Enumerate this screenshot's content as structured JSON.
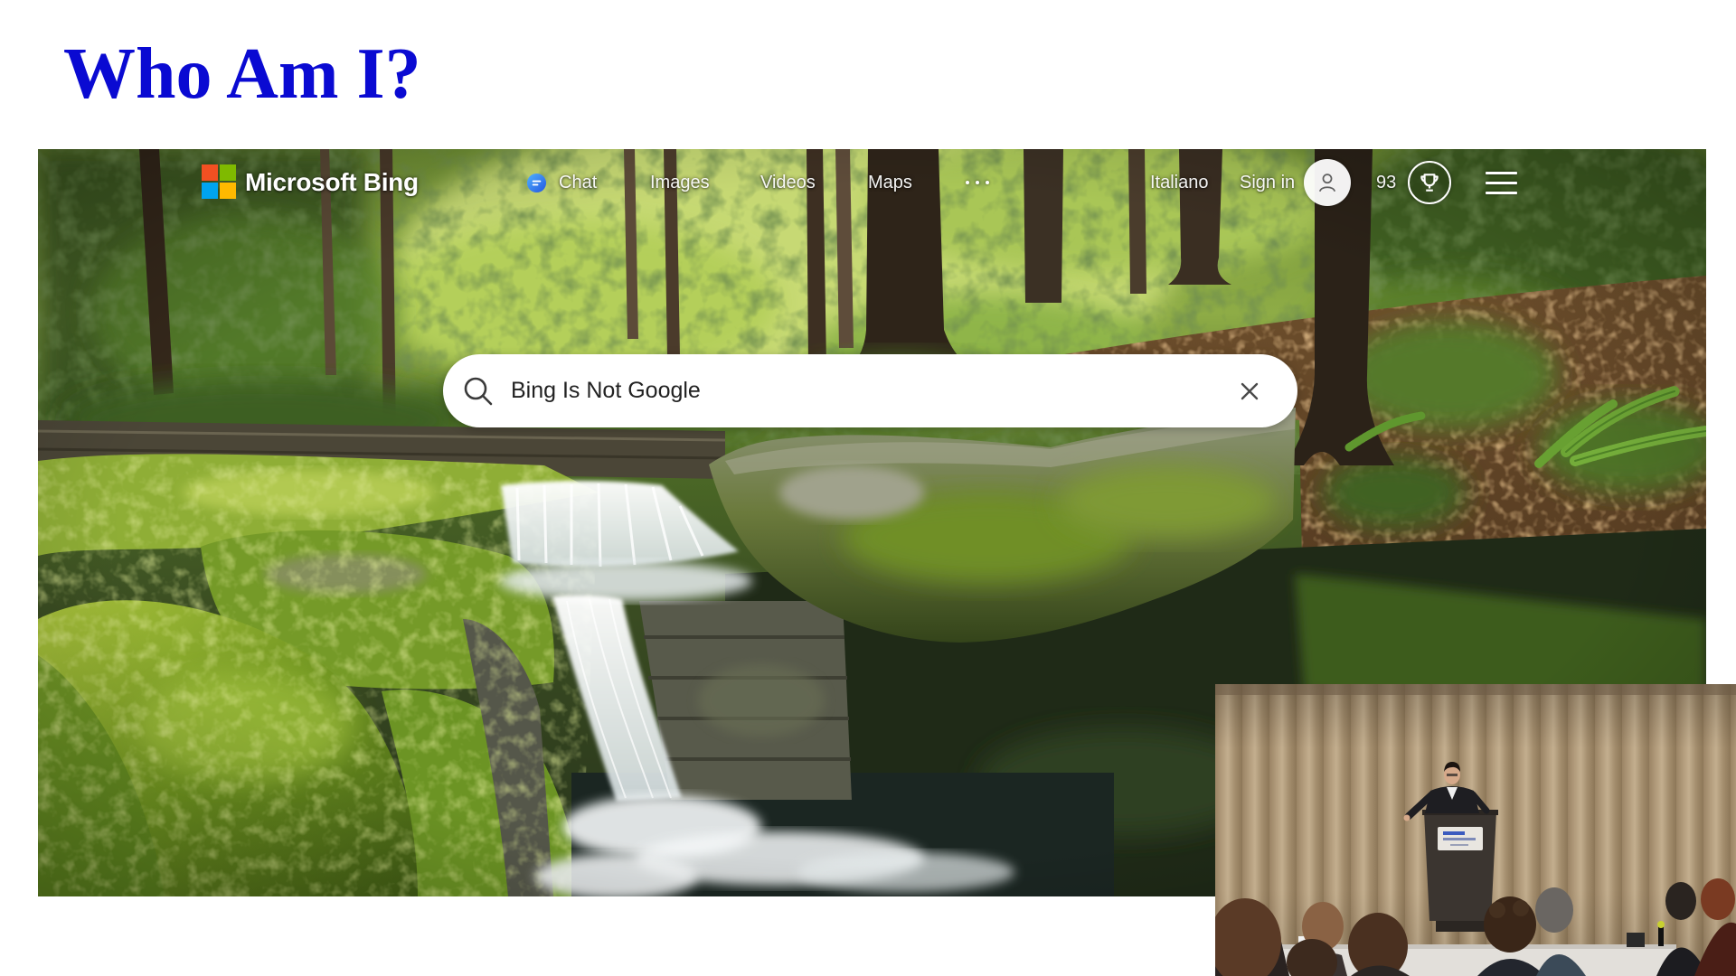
{
  "slide": {
    "title": "Who Am I?",
    "title_color": "#0a0ad2",
    "background": "#ffffff"
  },
  "bing": {
    "brand": "Microsoft Bing",
    "logo_icon": "microsoft-logo-icon",
    "logo_colors": [
      "#f25022",
      "#7fba00",
      "#00a4ef",
      "#ffb900"
    ],
    "nav": [
      {
        "label": "Chat",
        "icon": "copilot-chat-icon"
      },
      {
        "label": "Images"
      },
      {
        "label": "Videos"
      },
      {
        "label": "Maps"
      }
    ],
    "more_icon": "more-dots-icon",
    "language": "Italiano",
    "sign_in": "Sign in",
    "avatar_icon": "user-icon",
    "rewards": {
      "points": "93",
      "icon": "trophy-icon"
    },
    "menu_icon": "hamburger-menu-icon",
    "search": {
      "query": "Bing Is Not Google",
      "search_icon": "search-icon",
      "clear_icon": "close-icon",
      "box_color": "#ffffff"
    }
  }
}
